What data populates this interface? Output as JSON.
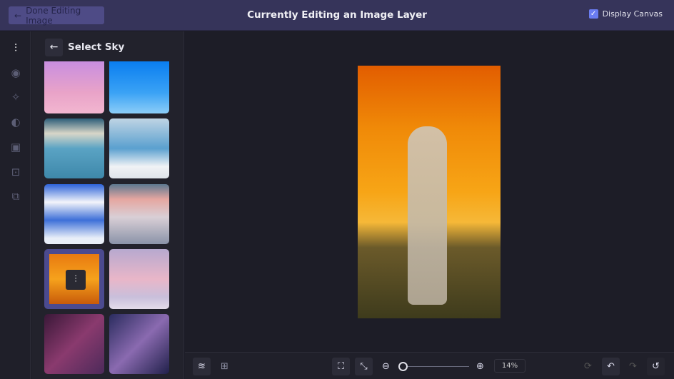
{
  "header": {
    "done_label": "Done Editing Image",
    "title": "Currently Editing an Image Layer",
    "display_canvas_label": "Display Canvas",
    "display_canvas_checked": true
  },
  "panel": {
    "title": "Select Sky"
  },
  "rail": {
    "icons": [
      "adjustments-icon",
      "eye-icon",
      "sparkles-icon",
      "palette-icon",
      "frame-icon",
      "mask-icon",
      "overlay-icon"
    ]
  },
  "skies": [
    "pink clouds",
    "clear blue",
    "sun rays",
    "white clouds",
    "blue cumulus",
    "cloud sea",
    "sunset orange",
    "pink dusk",
    "lightning",
    "galaxy"
  ],
  "selected_sky": 6,
  "bottom": {
    "zoom": "14%",
    "zoom_slider": 0.0
  }
}
